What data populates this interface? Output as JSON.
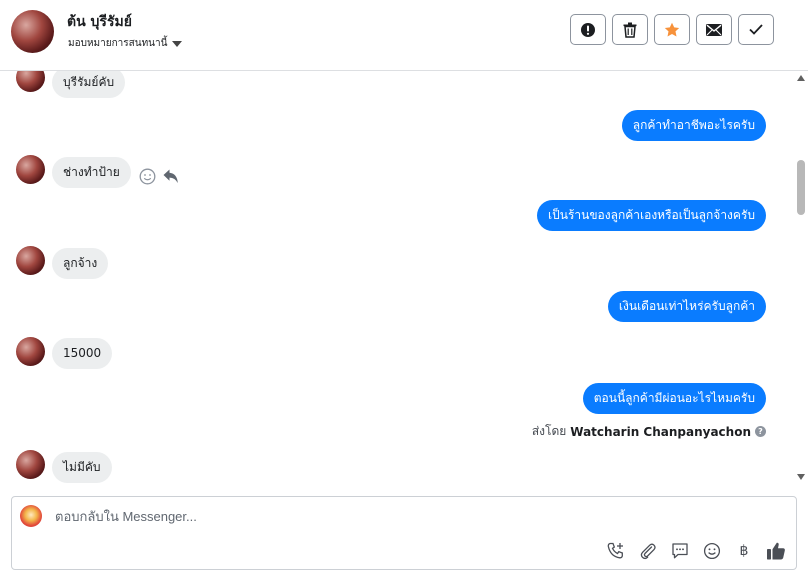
{
  "header": {
    "contact_name": "ต้น บุรีรัมย์",
    "assign_label": "มอบหมายการสนทนานี้",
    "actions": [
      "spam-icon",
      "trash-icon",
      "star-icon",
      "envelope-icon",
      "check-icon"
    ]
  },
  "messages": [
    {
      "from": "customer",
      "text": "บุรีรัมย์คับ"
    },
    {
      "from": "page",
      "text": "ลูกค้าทำอาชีพอะไรครับ"
    },
    {
      "from": "customer",
      "text": "ช่างทำป้าย"
    },
    {
      "from": "page",
      "text": "เป็นร้านของลูกค้าเองหรือเป็นลูกจ้างครับ"
    },
    {
      "from": "customer",
      "text": "ลูกจ้าง"
    },
    {
      "from": "page",
      "text": "เงินเดือนเท่าไหร่ครับลูกค้า"
    },
    {
      "from": "customer",
      "text": "15000"
    },
    {
      "from": "page",
      "text": "ตอนนี้ลูกค้ามีผ่อนอะไรไหมครับ"
    },
    {
      "from": "customer",
      "text": "ไม่มีคับ"
    }
  ],
  "sent_by": {
    "prefix": "ส่งโดย",
    "name": "Watcharin Chanpanyachon"
  },
  "composer": {
    "placeholder": "ตอบกลับใน Messenger..."
  },
  "colors": {
    "outgoing_bubble": "#0a7cff",
    "incoming_bubble": "#eceeef",
    "star": "#f7923b"
  }
}
